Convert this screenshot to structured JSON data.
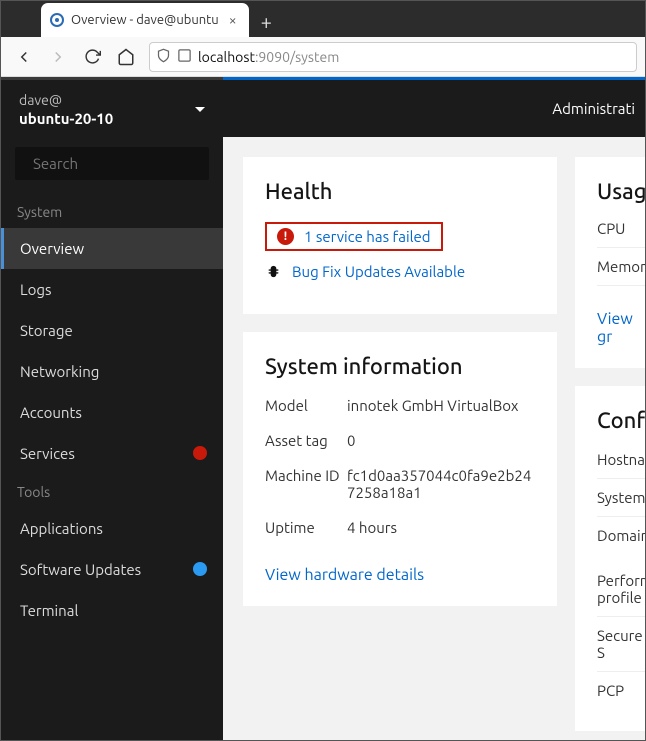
{
  "browser": {
    "tab_title": "Overview - dave@ubuntu",
    "url_host": "localhost",
    "url_port": ":9090",
    "url_path": "/system"
  },
  "topbar": {
    "right_link": "Administrati"
  },
  "sidebar": {
    "user": "dave@",
    "host": "ubuntu-20-10",
    "search_placeholder": "Search",
    "section1": "System",
    "items1": [
      {
        "label": "Overview",
        "active": true
      },
      {
        "label": "Logs"
      },
      {
        "label": "Storage"
      },
      {
        "label": "Networking"
      },
      {
        "label": "Accounts"
      },
      {
        "label": "Services",
        "badge": "red"
      }
    ],
    "section2": "Tools",
    "items2": [
      {
        "label": "Applications"
      },
      {
        "label": "Software Updates",
        "badge": "blue"
      },
      {
        "label": "Terminal"
      }
    ]
  },
  "health": {
    "title": "Health",
    "failed": "1 service has failed",
    "updates": "Bug Fix Updates Available"
  },
  "sysinfo": {
    "title": "System information",
    "rows": [
      {
        "label": "Model",
        "value": "innotek GmbH VirtualBox"
      },
      {
        "label": "Asset tag",
        "value": "0"
      },
      {
        "label": "Machine ID",
        "value": "fc1d0aa357044c0fa9e2b247258a18a1"
      },
      {
        "label": "Uptime",
        "value": "4 hours"
      }
    ],
    "hw_link": "View hardware details"
  },
  "usage": {
    "title": "Usage",
    "rows": [
      "CPU",
      "Memory"
    ],
    "link": "View gr"
  },
  "config": {
    "title": "Confi",
    "rows": [
      "Hostnam",
      "System",
      "Domain",
      "Perform profile",
      "Secure S",
      "PCP"
    ]
  }
}
